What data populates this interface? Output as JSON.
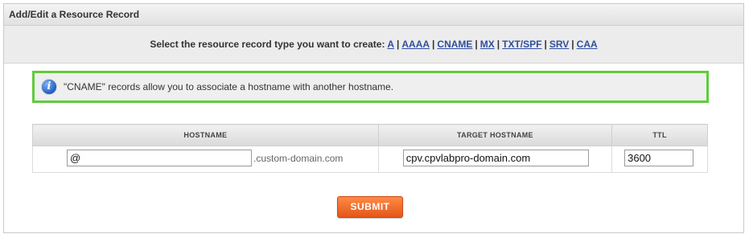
{
  "panel": {
    "title": "Add/Edit a Resource Record"
  },
  "type_selector": {
    "prompt": "Select the resource record type you want to create:",
    "types": [
      "A",
      "AAAA",
      "CNAME",
      "MX",
      "TXT/SPF",
      "SRV",
      "CAA"
    ],
    "separator": "|"
  },
  "info": {
    "icon": "info-icon",
    "message": "\"CNAME\" records allow you to associate a hostname with another hostname."
  },
  "record_table": {
    "headers": {
      "hostname": "HOSTNAME",
      "target": "TARGET HOSTNAME",
      "ttl": "TTL"
    },
    "row": {
      "hostname_value": "@",
      "hostname_suffix": ".custom-domain.com",
      "target_value": "cpv.cpvlabpro-domain.com",
      "ttl_value": "3600"
    }
  },
  "actions": {
    "submit_label": "SUBMIT"
  },
  "colors": {
    "info_border": "#5fcc3a",
    "submit_bg": "#f0682a",
    "link": "#2f4f9e"
  }
}
